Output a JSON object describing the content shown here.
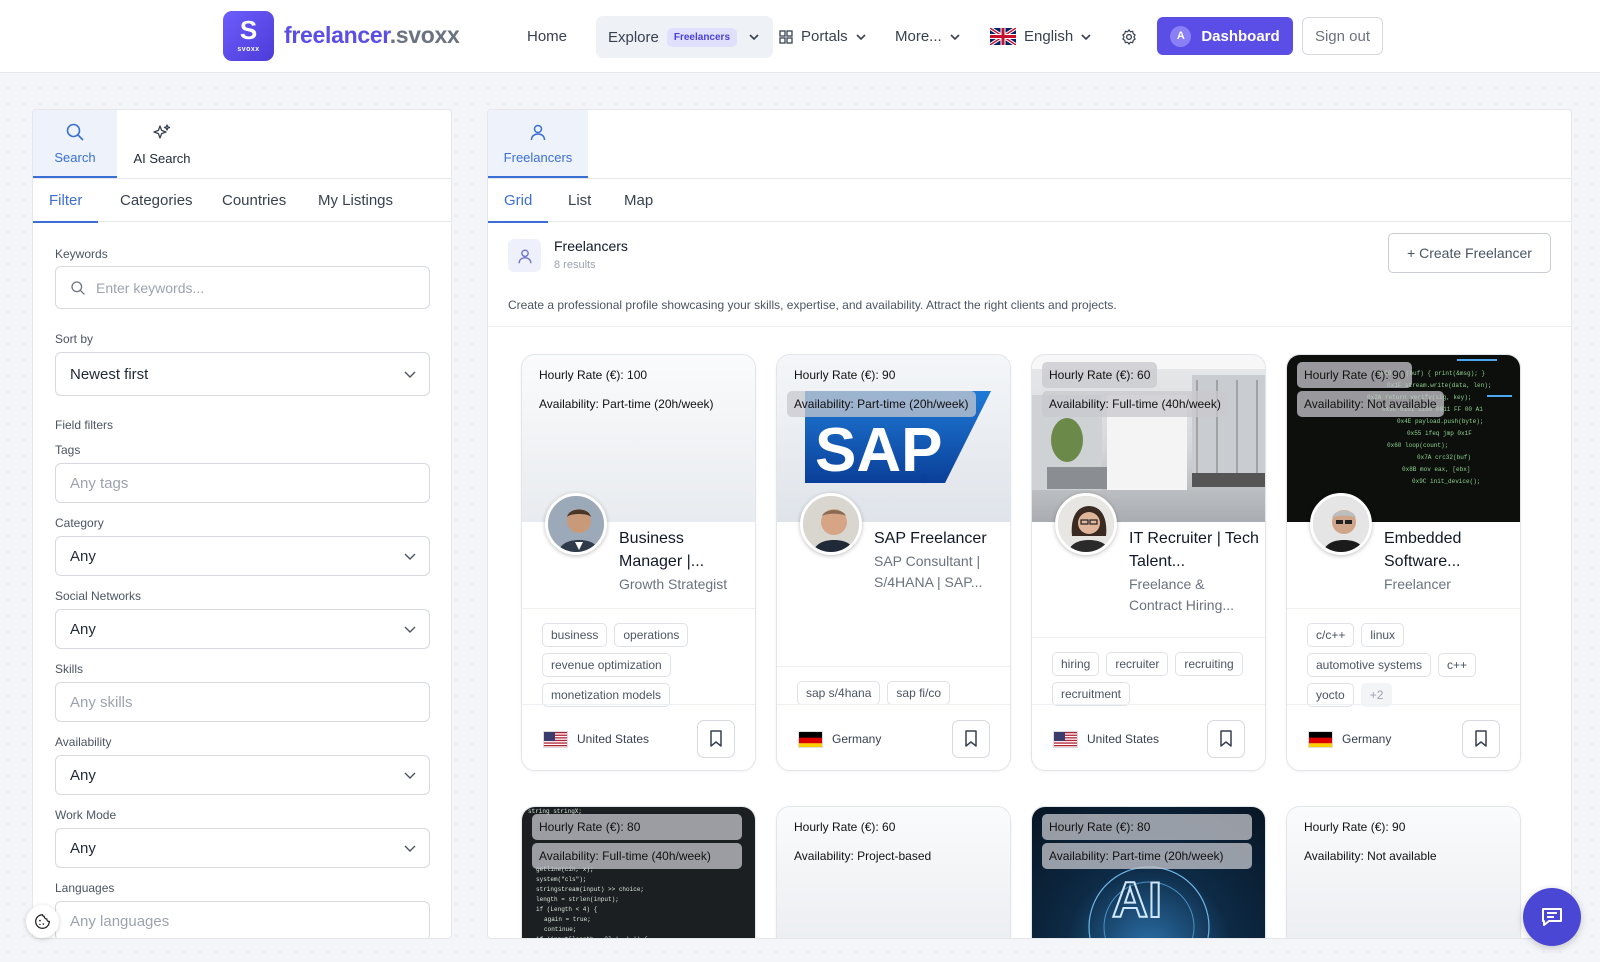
{
  "header": {
    "logo_letter": "S",
    "logo_sub": "svoxx",
    "brand_name": "freelancer",
    "brand_domain": ".svoxx",
    "nav": {
      "home": "Home",
      "explore": "Explore",
      "explore_badge": "Freelancers",
      "portals": "Portals",
      "more": "More...",
      "language": "English"
    },
    "dashboard_avatar": "A",
    "dashboard_label": "Dashboard",
    "signout_label": "Sign out"
  },
  "sidebar": {
    "mode_tabs": [
      {
        "label": "Search",
        "icon": "search-icon",
        "active": true
      },
      {
        "label": "AI Search",
        "icon": "sparkles-icon",
        "active": false
      }
    ],
    "tabs": [
      {
        "label": "Filter",
        "active": true
      },
      {
        "label": "Categories"
      },
      {
        "label": "Countries"
      },
      {
        "label": "My Listings"
      }
    ],
    "keywords": {
      "label": "Keywords",
      "placeholder": "Enter keywords..."
    },
    "sort": {
      "label": "Sort by",
      "value": "Newest first"
    },
    "field_filters_label": "Field filters",
    "tags": {
      "label": "Tags",
      "placeholder": "Any tags"
    },
    "category": {
      "label": "Category",
      "value": "Any"
    },
    "social": {
      "label": "Social Networks",
      "value": "Any"
    },
    "skills": {
      "label": "Skills",
      "placeholder": "Any skills"
    },
    "availability": {
      "label": "Availability",
      "value": "Any"
    },
    "work_mode": {
      "label": "Work Mode",
      "value": "Any"
    },
    "languages": {
      "label": "Languages",
      "placeholder": "Any languages"
    }
  },
  "main": {
    "mode_tab": "Freelancers",
    "view_tabs": [
      {
        "label": "Grid",
        "active": true
      },
      {
        "label": "List"
      },
      {
        "label": "Map"
      }
    ],
    "list_title": "Freelancers",
    "result_count": "8 results",
    "create_label": "+ Create Freelancer",
    "description": "Create a professional profile showcasing your skills, expertise, and availability. Attract the right clients and projects.",
    "rate_label": "Hourly Rate (€):",
    "availability_label": "Availability:",
    "cards": [
      {
        "rate": "100",
        "availability": "Part-time (20h/week)",
        "name": "Business Manager |...",
        "subtitle": "Growth Strategist",
        "tags": [
          "business",
          "operations",
          "revenue optimization",
          "monetization models"
        ],
        "country": "United States",
        "flag": "us",
        "image": "light"
      },
      {
        "rate": "90",
        "availability": "Part-time (20h/week)",
        "name": "SAP Freelancer",
        "subtitle": "SAP Consultant | S/4HANA | SAP...",
        "tags": [
          "sap s/4hana",
          "sap fi/co"
        ],
        "country": "Germany",
        "flag": "de",
        "image": "sap",
        "image_text": "SAP"
      },
      {
        "rate": "60",
        "availability": "Full-time (40h/week)",
        "name": "IT Recruiter | Tech Talent...",
        "subtitle": "Freelance & Contract Hiring...",
        "tags": [
          "hiring",
          "recruiter",
          "recruiting",
          "recruitment"
        ],
        "country": "United States",
        "flag": "us",
        "image": "office"
      },
      {
        "rate": "90",
        "availability": "Not available",
        "name": "Embedded Software...",
        "subtitle": "Freelancer",
        "tags": [
          "c/c++",
          "linux",
          "automotive systems",
          "c++",
          "yocto",
          "+2"
        ],
        "country": "Germany",
        "flag": "de",
        "image": "code"
      },
      {
        "rate": "80",
        "availability": "Full-time (40h/week)",
        "image": "code2"
      },
      {
        "rate": "60",
        "availability": "Project-based",
        "image": "light"
      },
      {
        "rate": "80",
        "availability": "Part-time (20h/week)",
        "image": "ai",
        "image_text": "AI"
      },
      {
        "rate": "90",
        "availability": "Not available",
        "image": "light"
      }
    ]
  }
}
